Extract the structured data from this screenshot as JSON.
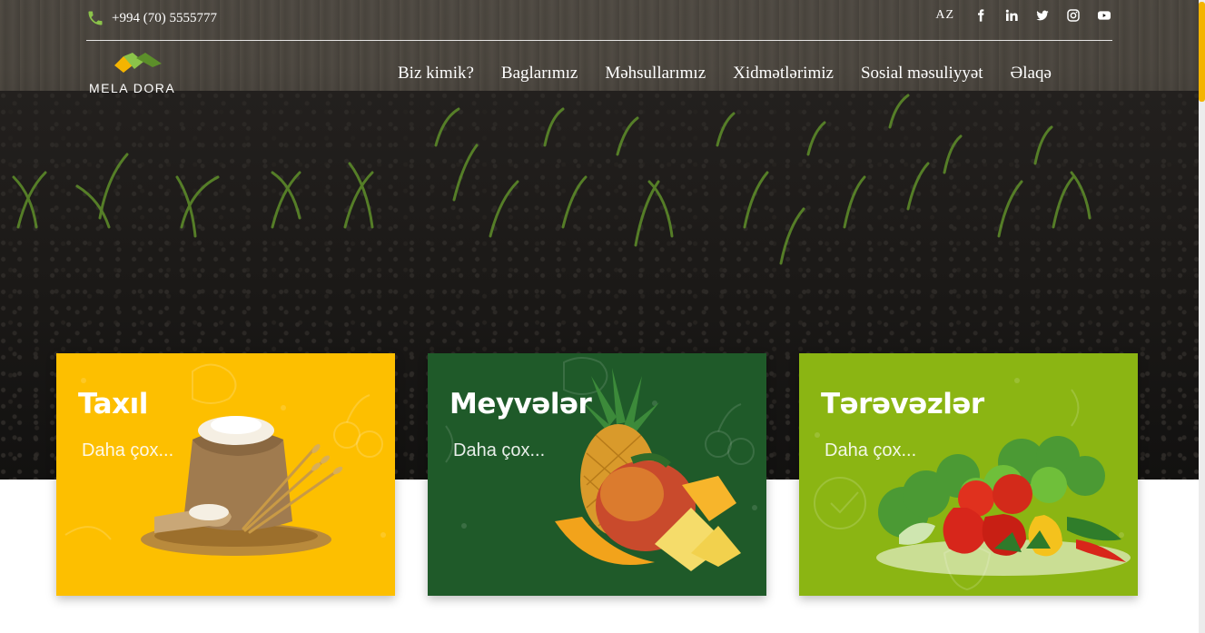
{
  "topbar": {
    "phone": "+994 (70) 5555777",
    "phone_icon": "phone-icon",
    "language": "AZ",
    "social": [
      {
        "name": "facebook-icon"
      },
      {
        "name": "linkedin-icon"
      },
      {
        "name": "twitter-icon"
      },
      {
        "name": "instagram-icon"
      },
      {
        "name": "youtube-icon"
      }
    ]
  },
  "logo": {
    "text": "MELA DORA"
  },
  "nav": {
    "items": [
      "Biz kimik?",
      "Baglarımız",
      "Məhsullarımız",
      "Xidmətlərimiz",
      "Sosial məsuliyyət",
      "Əlaqə"
    ]
  },
  "cards": [
    {
      "title": "Taxıl",
      "more": "Daha çox...",
      "color": "#fdbf00",
      "image": "flour-sack-wheat"
    },
    {
      "title": "Meyvələr",
      "more": "Daha çox...",
      "color": "#1f5a29",
      "image": "pineapple-mango"
    },
    {
      "title": "Tərəvəzlər",
      "more": "Daha çox...",
      "color": "#8bb513",
      "image": "vegetables"
    }
  ],
  "colors": {
    "accent": "#f4b400",
    "phone_green": "#8bc34a"
  }
}
